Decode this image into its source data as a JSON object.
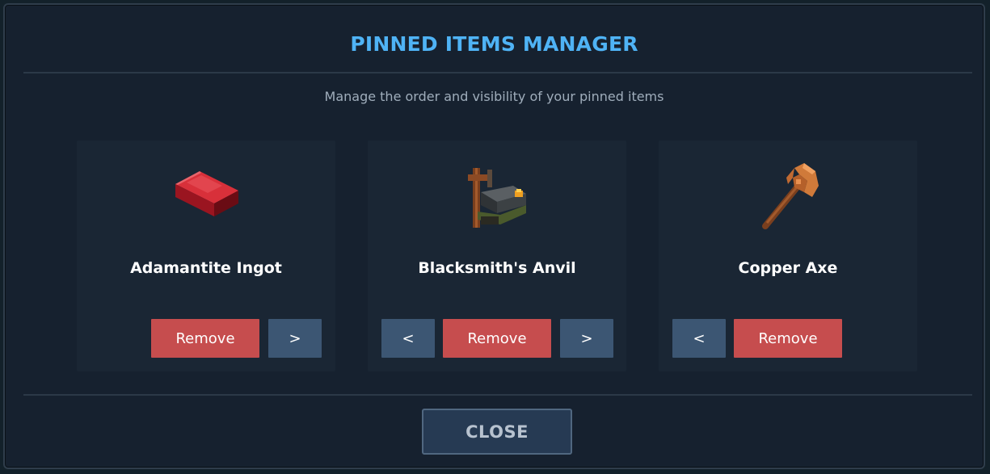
{
  "modal": {
    "title": "PINNED ITEMS MANAGER",
    "subtitle": "Manage the order and visibility of your pinned items",
    "close_label": "CLOSE"
  },
  "items": [
    {
      "name": "Adamantite Ingot",
      "icon": "adamantite-ingot-icon",
      "buttons": {
        "prev": null,
        "remove": "Remove",
        "next": ">"
      }
    },
    {
      "name": "Blacksmith's Anvil",
      "icon": "blacksmith-anvil-icon",
      "buttons": {
        "prev": "<",
        "remove": "Remove",
        "next": ">"
      }
    },
    {
      "name": "Copper Axe",
      "icon": "copper-axe-icon",
      "buttons": {
        "prev": "<",
        "remove": "Remove",
        "next": null
      }
    }
  ],
  "colors": {
    "title": "#4fb3f5",
    "remove_button": "#c64d4e",
    "nav_button": "#3c5673",
    "card_bg": "#1a2634",
    "modal_bg": "#16212f"
  }
}
